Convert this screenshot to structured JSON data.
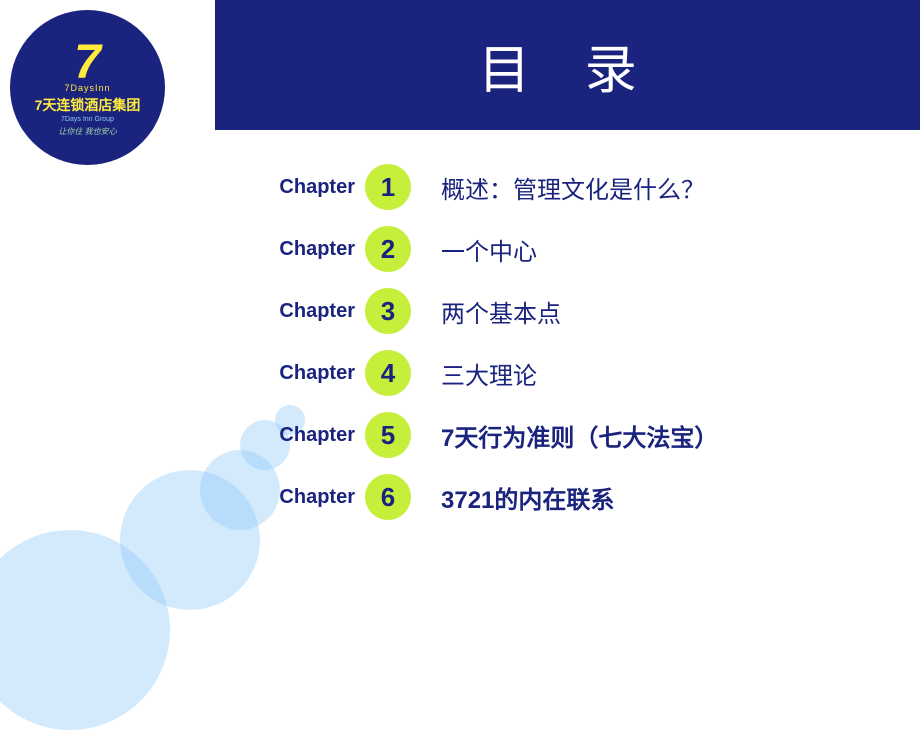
{
  "logo": {
    "seven": "7",
    "seven_days_en": "7DaysInn",
    "chinese_name": "7天连锁酒店集团",
    "english_name": "7Days Inn Group",
    "slogan": "让你住 我也安心"
  },
  "header": {
    "title": "目   录"
  },
  "chapters": [
    {
      "label": "Chapter",
      "number": "1",
      "text": "概述：管理文化是什么？",
      "bold": false
    },
    {
      "label": "Chapter",
      "number": "2",
      "text": "一个中心",
      "bold": false
    },
    {
      "label": "Chapter",
      "number": "3",
      "text": "两个基本点",
      "bold": false
    },
    {
      "label": "Chapter",
      "number": "4",
      "text": "三大理论",
      "bold": false
    },
    {
      "label": "Chapter",
      "number": "5",
      "text": "7天行为准则（七大法宝）",
      "bold": true
    },
    {
      "label": "Chapter",
      "number": "6",
      "text": "3721的内在联系",
      "bold": true
    }
  ],
  "colors": {
    "navy": "#1a237e",
    "green_circle": "#c6ef3b",
    "light_blue_deco": "rgba(144,202,249,0.4)"
  }
}
